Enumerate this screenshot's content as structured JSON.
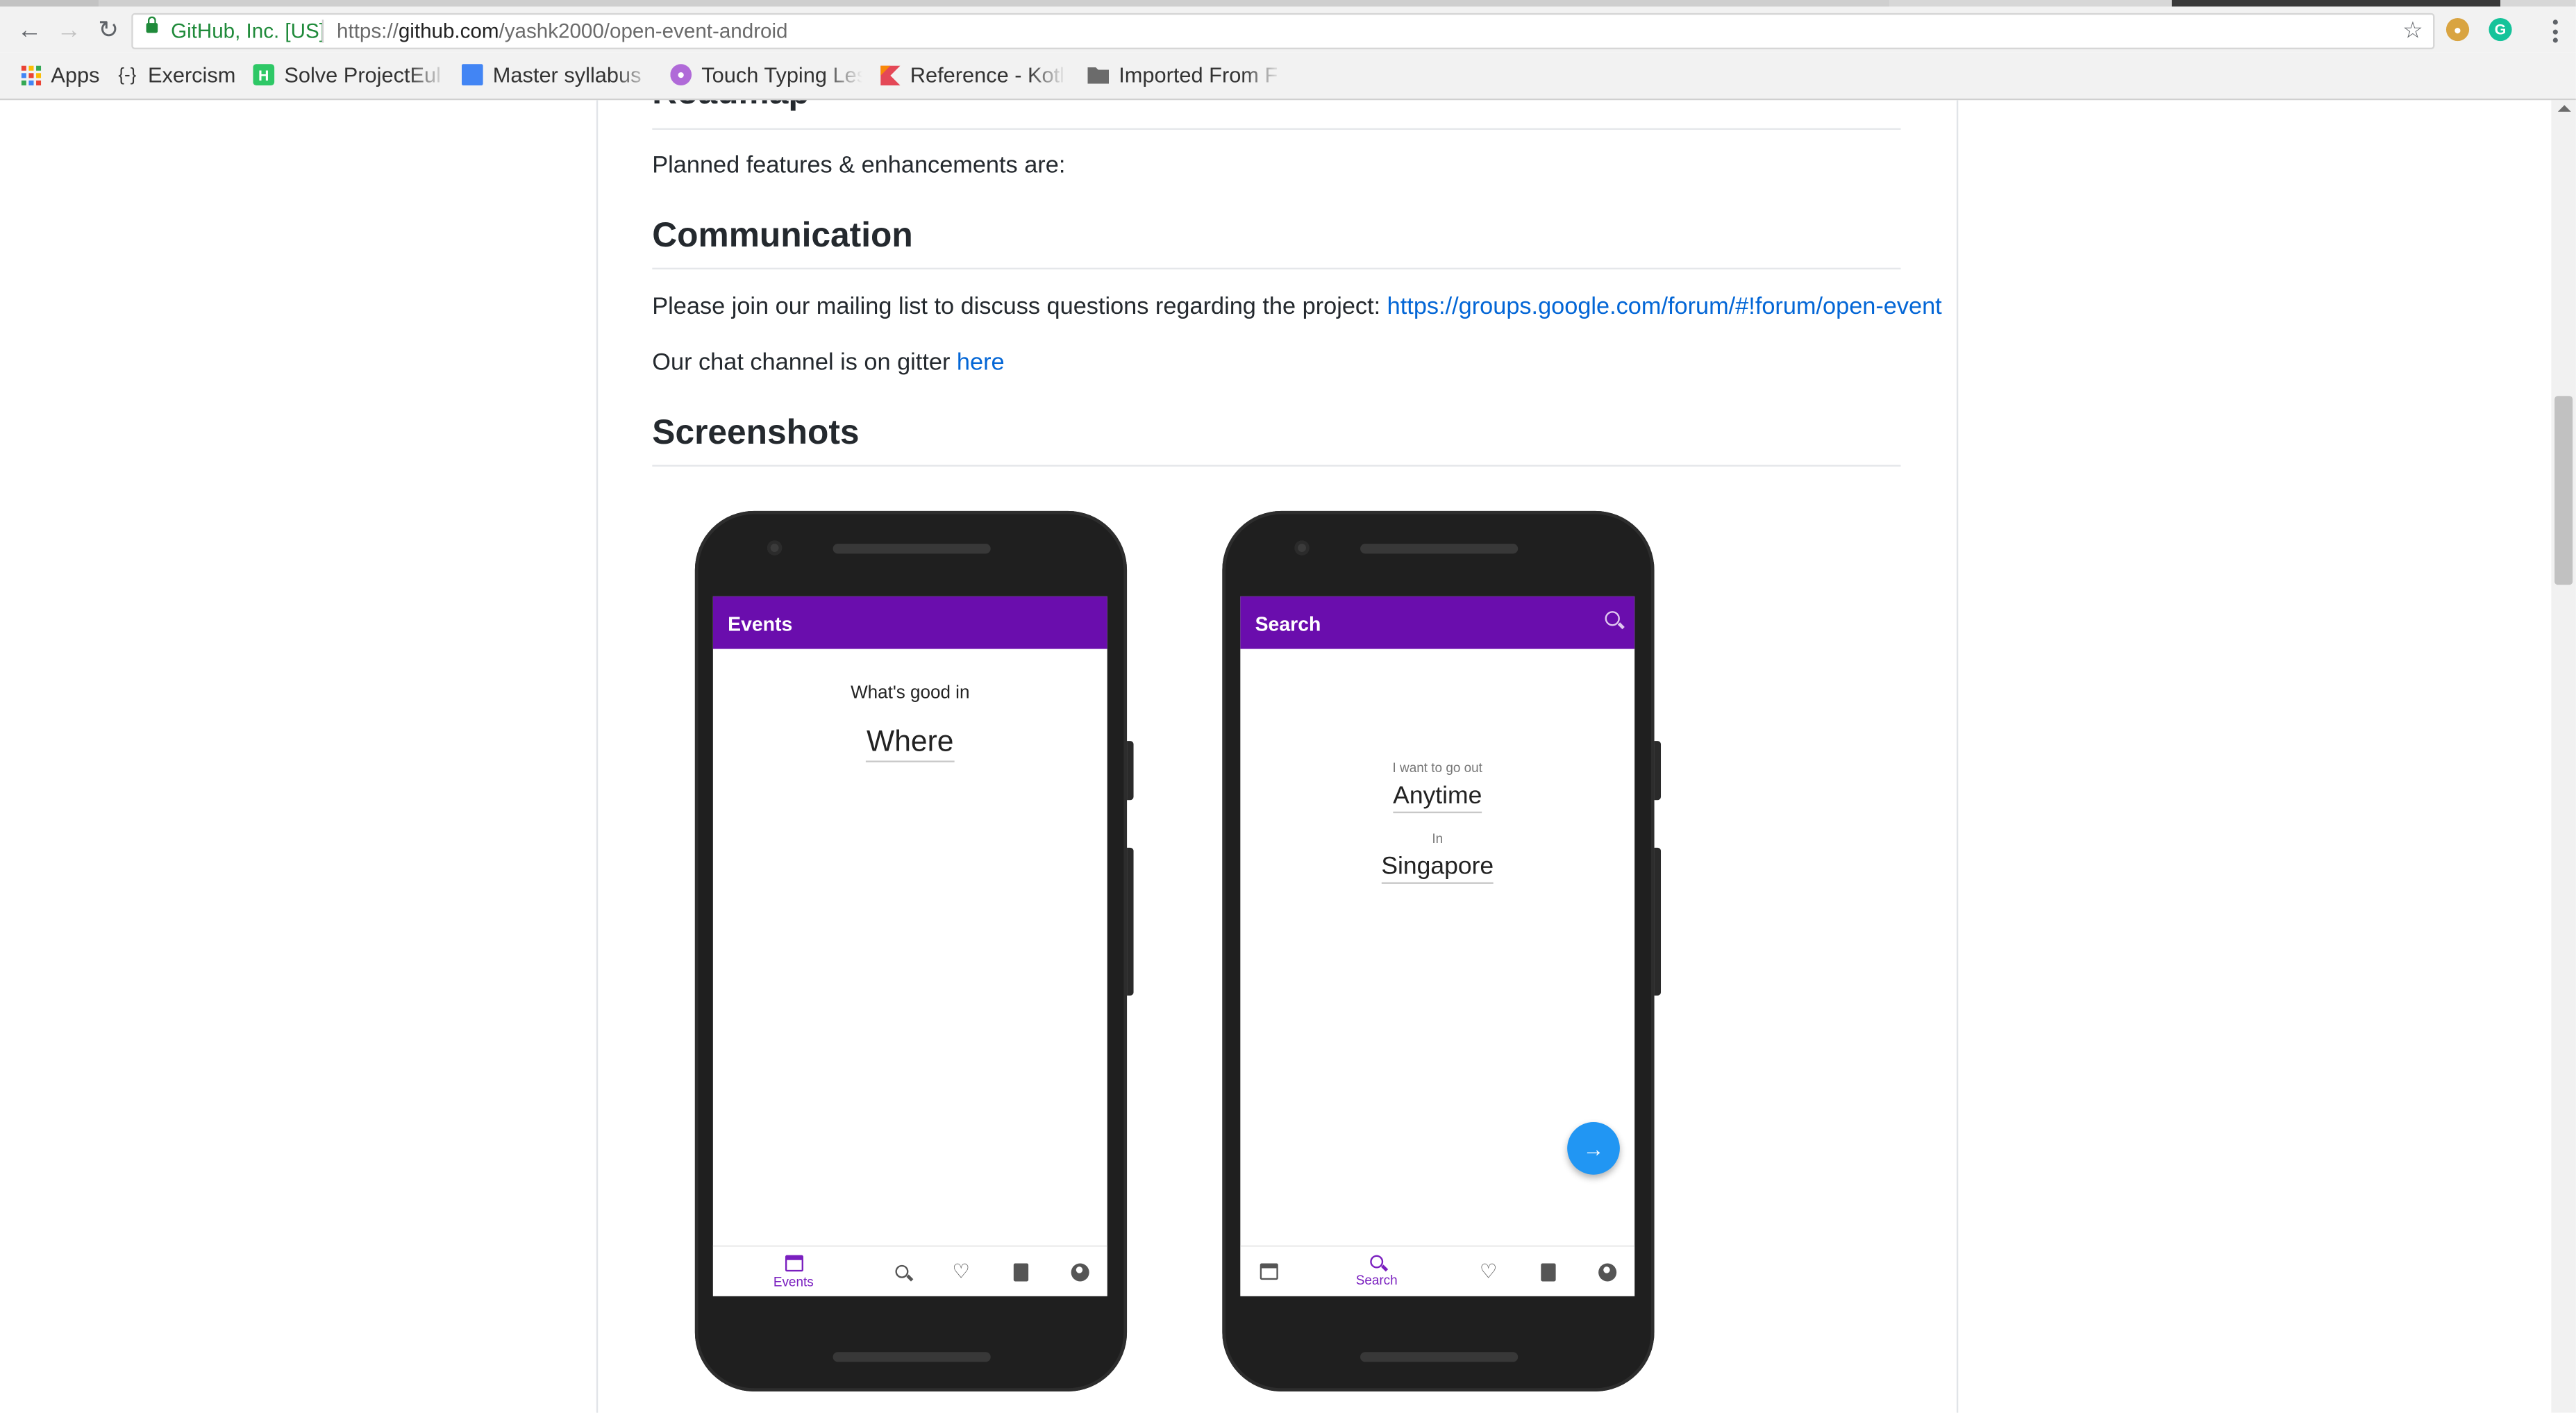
{
  "browser": {
    "site_identity": "GitHub, Inc. [US]",
    "url_scheme": "https://",
    "url_host": "github.com",
    "url_path": "/yashk2000/open-event-android",
    "bookmarks": [
      {
        "label": "Apps",
        "icon": "apps-grid-icon"
      },
      {
        "label": "Exercism",
        "icon": "exercism-icon"
      },
      {
        "label": "Solve ProjectEul",
        "icon": "hackerrank-icon"
      },
      {
        "label": "Master syllabus",
        "icon": "docs-icon"
      },
      {
        "label": "Touch Typing Les",
        "icon": "typing-icon"
      },
      {
        "label": "Reference - Kotl",
        "icon": "kotlin-icon"
      },
      {
        "label": "Imported From F",
        "icon": "folder-icon"
      }
    ],
    "ext_colors": {
      "cookie": "#d9a441",
      "grammarly": "#15c39a"
    }
  },
  "readme": {
    "roadmap_heading": "Roadmap",
    "roadmap_text": "Planned features & enhancements are:",
    "communication_heading": "Communication",
    "mailing_text": "Please join our mailing list to discuss questions regarding the project: ",
    "mailing_link": "https://groups.google.com/forum/#!forum/open-event",
    "chat_text": "Our chat channel is on gitter ",
    "chat_link": "here",
    "screenshots_heading": "Screenshots"
  },
  "phone_events": {
    "appbar_title": "Events",
    "prompt": "What's good in",
    "location": "Where",
    "nav_active_label": "Events"
  },
  "phone_search": {
    "appbar_title": "Search",
    "prompt": "I want to go out",
    "time": "Anytime",
    "in_label": "In",
    "location": "Singapore",
    "nav_active_label": "Search"
  },
  "colors": {
    "appbar": "#6a0dad",
    "link": "#0366d6",
    "fab": "#2196f3"
  }
}
